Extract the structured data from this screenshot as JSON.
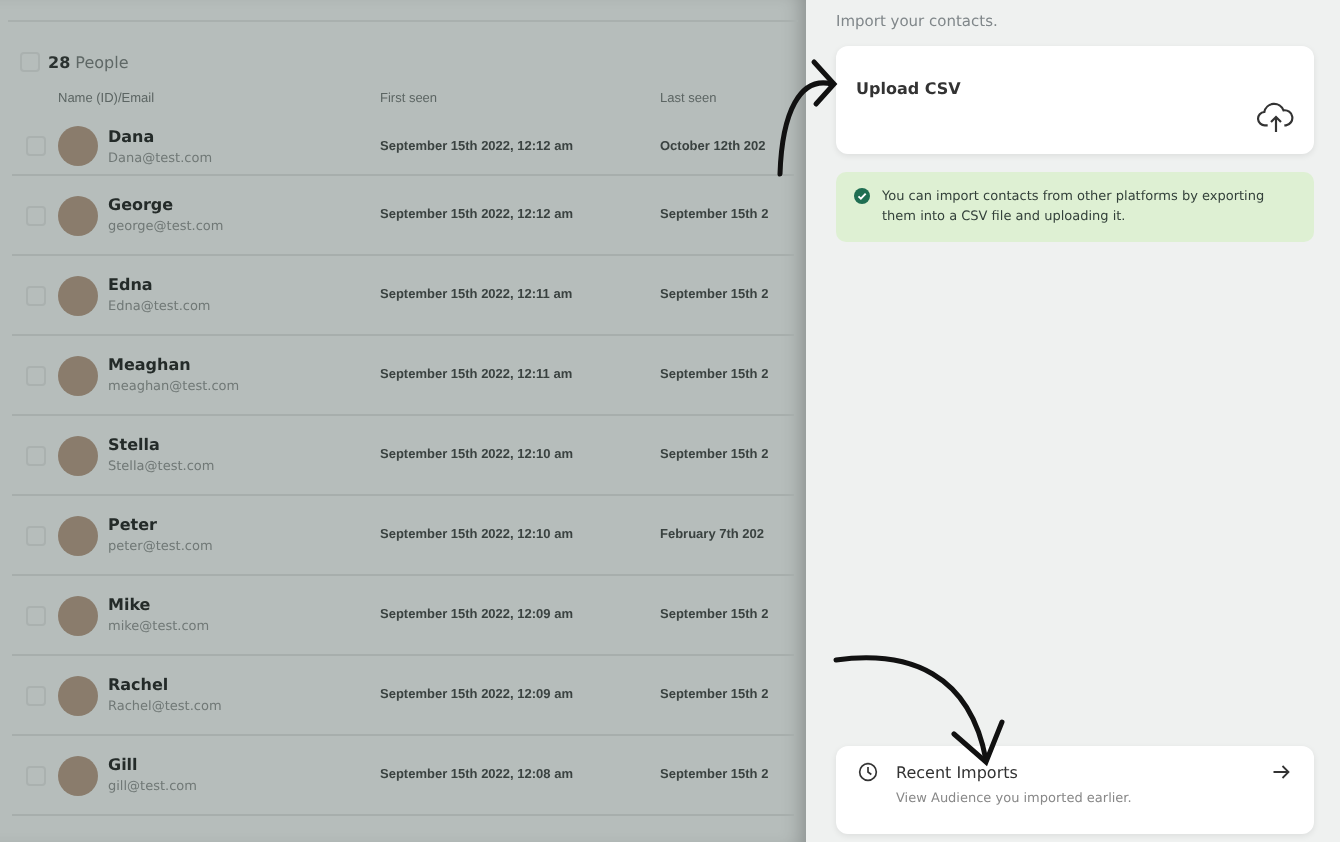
{
  "people_list": {
    "select_all_checked": false,
    "count": "28",
    "count_label": "People",
    "columns": [
      "Name (ID)/Email",
      "First seen",
      "Last seen"
    ],
    "rows": [
      {
        "name": "Dana",
        "email": "Dana@test.com",
        "first_seen": "September 15th 2022, 12:12 am",
        "last_seen": "October 12th 202",
        "selected": false
      },
      {
        "name": "George",
        "email": "george@test.com",
        "first_seen": "September 15th 2022, 12:12 am",
        "last_seen": "September 15th 2",
        "selected": false
      },
      {
        "name": "Edna",
        "email": "Edna@test.com",
        "first_seen": "September 15th 2022, 12:11 am",
        "last_seen": "September 15th 2",
        "selected": false
      },
      {
        "name": "Meaghan",
        "email": "meaghan@test.com",
        "first_seen": "September 15th 2022, 12:11 am",
        "last_seen": "September 15th 2",
        "selected": false
      },
      {
        "name": "Stella",
        "email": "Stella@test.com",
        "first_seen": "September 15th 2022, 12:10 am",
        "last_seen": "September 15th 2",
        "selected": false
      },
      {
        "name": "Peter",
        "email": "peter@test.com",
        "first_seen": "September 15th 2022, 12:10 am",
        "last_seen": "February 7th 202",
        "selected": false
      },
      {
        "name": "Mike",
        "email": "mike@test.com",
        "first_seen": "September 15th 2022, 12:09 am",
        "last_seen": "September 15th 2",
        "selected": false
      },
      {
        "name": "Rachel",
        "email": "Rachel@test.com",
        "first_seen": "September 15th 2022, 12:09 am",
        "last_seen": "September 15th 2",
        "selected": false
      },
      {
        "name": "Gill",
        "email": "gill@test.com",
        "first_seen": "September 15th 2022, 12:08 am",
        "last_seen": "September 15th 2",
        "selected": false
      }
    ]
  },
  "import_panel": {
    "intro": "Import your contacts.",
    "upload_card": {
      "title": "Upload CSV"
    },
    "info_note": "You can import contacts from other platforms by exporting them into a CSV file and uploading it.",
    "recent_imports": {
      "title": "Recent Imports",
      "subtitle": "View Audience you imported earlier."
    }
  }
}
